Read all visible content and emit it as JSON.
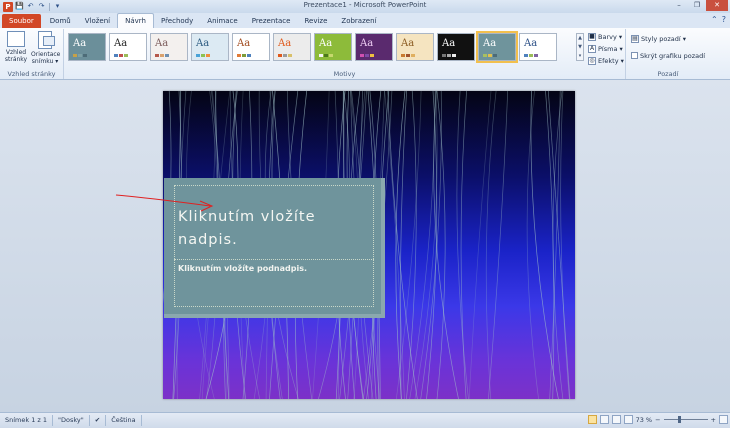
{
  "window": {
    "title": "Prezentace1 - Microsoft PowerPoint",
    "app_icon": "P",
    "controls": [
      "–",
      "❐",
      "✕"
    ]
  },
  "qat": {
    "save": "💾",
    "undo": "↶",
    "redo": "↷",
    "more": "▾"
  },
  "tabs": [
    {
      "label": "Soubor"
    },
    {
      "label": "Domů"
    },
    {
      "label": "Vložení"
    },
    {
      "label": "Návrh"
    },
    {
      "label": "Přechody"
    },
    {
      "label": "Animace"
    },
    {
      "label": "Prezentace"
    },
    {
      "label": "Revize"
    },
    {
      "label": "Zobrazení"
    }
  ],
  "active_tab": "Návrh",
  "tab_right": {
    "minimize": "⌃",
    "help": "?"
  },
  "ribbon": {
    "page_setup": {
      "group_label": "Vzhled stránky",
      "btn1_line1": "Vzhled",
      "btn1_line2": "stránky",
      "btn2_line1": "Orientace",
      "btn2_line2": "snímku ▾"
    },
    "themes": {
      "group_label": "Motivy",
      "thumb_text": "Aa",
      "items": [
        {
          "bg": "#6b8f9a",
          "fg": "#ffffff",
          "b": [
            "#c6a148",
            "#7ea0a6",
            "#4d6c78"
          ]
        },
        {
          "bg": "#ffffff",
          "fg": "#222222",
          "b": [
            "#4f81bd",
            "#c0504d",
            "#9bbb59"
          ]
        },
        {
          "bg": "#f3f0ee",
          "fg": "#7a5a5a",
          "b": [
            "#b5584b",
            "#d9a16c",
            "#6e8fb0"
          ]
        },
        {
          "bg": "#dceaf3",
          "fg": "#2a5a80",
          "b": [
            "#4aa3d8",
            "#8cc152",
            "#f08c3c"
          ]
        },
        {
          "bg": "#ffffff",
          "fg": "#a04a1e",
          "b": [
            "#e07b39",
            "#7d9c3a",
            "#4f81bd"
          ]
        },
        {
          "bg": "#ececec",
          "fg": "#e0591b",
          "b": [
            "#e0591b",
            "#9a9a9a",
            "#d9c06a"
          ]
        },
        {
          "bg": "#8dbb3a",
          "fg": "#ffffff",
          "b": [
            "#f5f5f5",
            "#4c7a1a",
            "#c6d86e"
          ]
        },
        {
          "bg": "#5a2a6e",
          "fg": "#f0d0f5",
          "b": [
            "#d050b0",
            "#7d4aa5",
            "#f0c040"
          ]
        },
        {
          "bg": "#f5e4c0",
          "fg": "#8a5a20",
          "b": [
            "#c87a30",
            "#a0522d",
            "#e0b060"
          ]
        },
        {
          "bg": "#111111",
          "fg": "#ffffff",
          "b": [
            "#777777",
            "#aaaaaa",
            "#eeeeee"
          ]
        },
        {
          "bg": "#6f949c",
          "fg": "#ffffff",
          "b": [
            "#a8c060",
            "#e0c050",
            "#4d6c78"
          ]
        },
        {
          "bg": "#ffffff",
          "fg": "#2b4f86",
          "b": [
            "#4f81bd",
            "#9bbb59",
            "#8064a2"
          ]
        }
      ],
      "selected_index": 10
    },
    "theme_options": {
      "colors": "Barvy ▾",
      "fonts": "Písma ▾",
      "effects": "Efekty ▾"
    },
    "background": {
      "group_label": "Pozadí",
      "styles": "Styly pozadí ▾",
      "hide": "Skrýt grafiku pozadí"
    }
  },
  "slide": {
    "title": "Kliknutím vložíte nadpis.",
    "subtitle": "Kliknutím vložíte podnadpis."
  },
  "status": {
    "slide": "Snímek 1 z 1",
    "theme": "\"Dosky\"",
    "language": "Čeština",
    "zoom": "73 %",
    "minus": "−",
    "plus": "+"
  },
  "colors": {
    "file_tab": "#d24726",
    "ribbon": "#e3ecf7",
    "selected_outline": "#f2c04e"
  }
}
